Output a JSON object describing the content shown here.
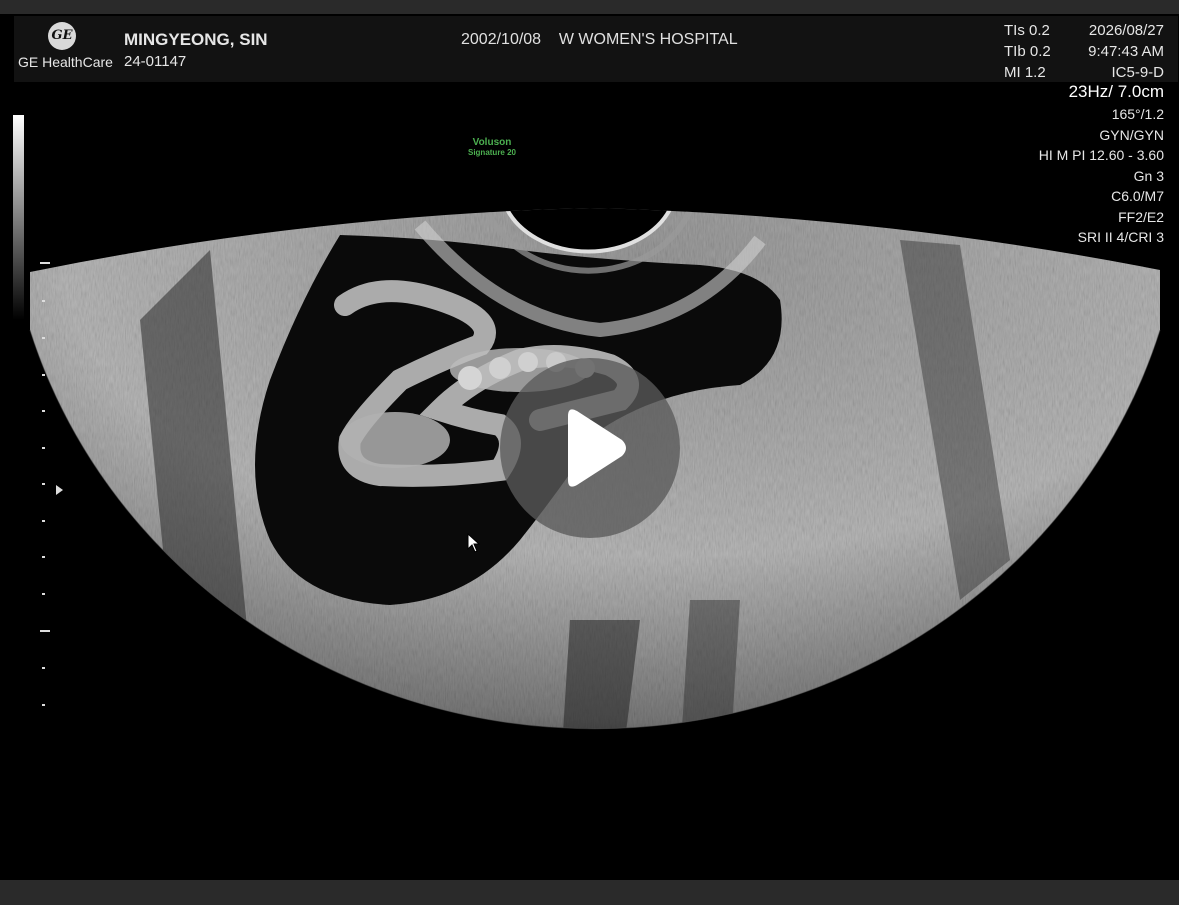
{
  "header": {
    "logo_text": "GE",
    "brand": "GE HealthCare",
    "patient_name": "MINGYEONG, SIN",
    "patient_id": "24-01147",
    "birth_date": "2002/10/08",
    "hospital": "W WOMEN'S HOSPITAL",
    "tis_label": "TIs",
    "tis_value": "0.2",
    "tib_label": "TIb",
    "tib_value": "0.2",
    "mi_label": "MI",
    "mi_value": "1.2",
    "date": "2026/08/27",
    "time": "9:47:43 AM",
    "probe": "IC5-9-D"
  },
  "parameters": {
    "frequency": "23Hz/ 7.0cm",
    "angle": "165°/1.2",
    "preset": "GYN/GYN",
    "hi_pi": "HI M PI 12.60 - 3.60",
    "gain": "Gn  3",
    "color_map": "C6.0/M7",
    "ff_e": "FF2/E2",
    "sri": "SRI II 4/CRI 3"
  },
  "watermark": {
    "line1": "Voluson",
    "line2": "Signature 20"
  },
  "colors": {
    "frame_bg": "#000000",
    "bar_bg": "#121212",
    "watermark": "#4caf50",
    "play_overlay": "#5a5a5a"
  },
  "icons": {
    "play": "play-icon",
    "cursor": "mouse-pointer-icon",
    "logo": "ge-monogram-icon"
  }
}
